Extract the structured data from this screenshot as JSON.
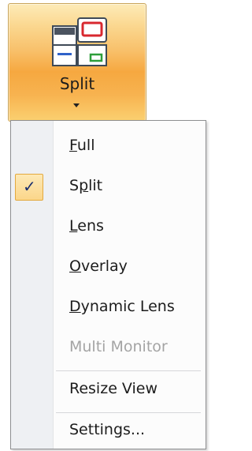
{
  "ribbon": {
    "split_button": {
      "label": "Split",
      "icon": "split-view-icon",
      "state": "pressed"
    }
  },
  "menu": {
    "items": [
      {
        "label": "Full",
        "mnemonic": "F",
        "rest": "ull",
        "checked": false,
        "enabled": true
      },
      {
        "label": "Split",
        "mnemonic_pre": "S",
        "mnemonic": "p",
        "rest": "lit",
        "checked": true,
        "enabled": true
      },
      {
        "label": "Lens",
        "mnemonic": "L",
        "rest": "ens",
        "checked": false,
        "enabled": true
      },
      {
        "label": "Overlay",
        "mnemonic": "O",
        "rest": "verlay",
        "checked": false,
        "enabled": true
      },
      {
        "label": "Dynamic Lens",
        "mnemonic": "D",
        "rest": "ynamic Lens",
        "checked": false,
        "enabled": true
      },
      {
        "label": "Multi Monitor",
        "checked": false,
        "enabled": false
      },
      {
        "label": "Resize View",
        "checked": false,
        "enabled": true
      },
      {
        "label": "Settings...",
        "checked": false,
        "enabled": true
      }
    ],
    "check_glyph": "✓",
    "check_icon": "checkmark-icon"
  },
  "colors": {
    "button_highlight": "#f6a840",
    "check_highlight": "#fbd68a",
    "disabled_text": "#a4a4a4"
  }
}
